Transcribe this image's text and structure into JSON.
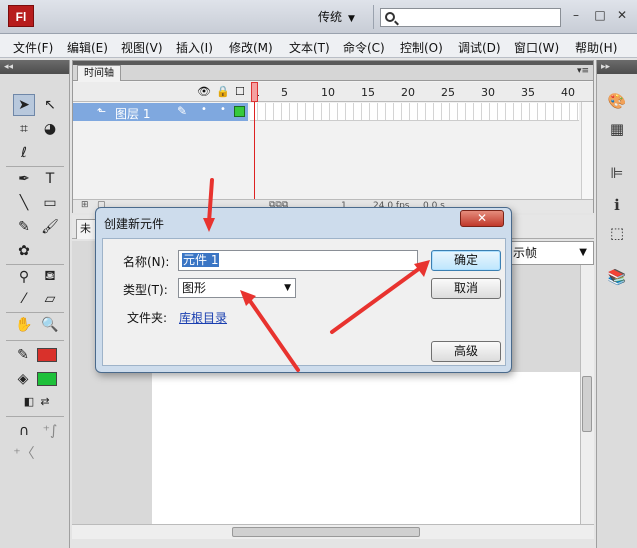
{
  "app": {
    "logo": "Fl",
    "workspace": "传统",
    "window_controls": [
      "minimize-icon",
      "maximize-icon",
      "close-icon"
    ]
  },
  "menu": [
    "文件(F)",
    "编辑(E)",
    "视图(V)",
    "插入(I)",
    "修改(M)",
    "文本(T)",
    "命令(C)",
    "控制(O)",
    "调试(D)",
    "窗口(W)",
    "帮助(H)"
  ],
  "timeline": {
    "tab": "时间轴",
    "layer": "图层 1",
    "frame_numbers": [
      "1",
      "5",
      "10",
      "15",
      "20",
      "25",
      "30",
      "35",
      "40"
    ],
    "footer_frame": "1",
    "footer_fps": "24.0 fps",
    "footer_time": "0.0 s"
  },
  "editbar": {
    "scene_tab": "未",
    "frame_view": "示帧"
  },
  "dialog": {
    "title": "创建新元件",
    "name_label": "名称(N):",
    "name_value": "元件 1",
    "type_label": "类型(T):",
    "type_value": "图形",
    "folder_label": "文件夹:",
    "folder_value": "库根目录",
    "ok": "确定",
    "cancel": "取消",
    "advanced": "高级"
  },
  "colors": {
    "stroke": "#d9312b",
    "fill": "#1ec03a",
    "annotation_arrow": "#e8332f"
  }
}
